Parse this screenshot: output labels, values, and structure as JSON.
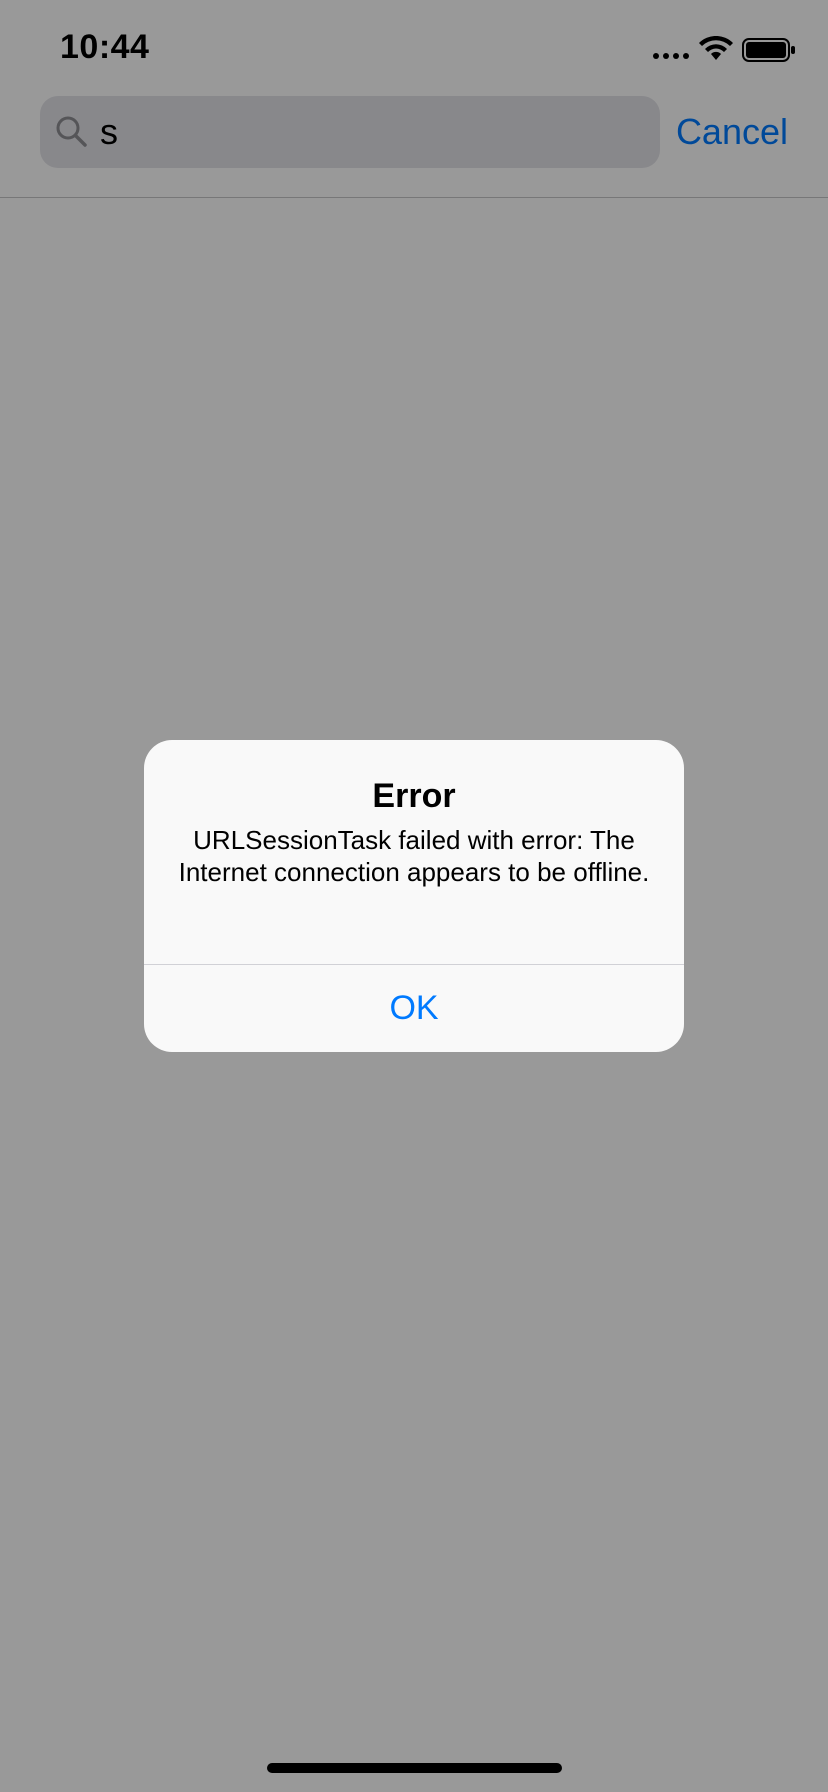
{
  "status_bar": {
    "time": "10:44",
    "icons": [
      "signal-dots-icon",
      "wifi-icon",
      "battery-icon"
    ]
  },
  "search": {
    "query": "s",
    "cancel_label": "Cancel"
  },
  "alert": {
    "title": "Error",
    "message": "URLSessionTask failed with error: The Internet connection appears to be offline.",
    "ok_label": "OK"
  },
  "colors": {
    "accent": "#007aff",
    "dim": "rgba(0,0,0,0.40)",
    "alert_bg": "#f9f9f9"
  }
}
